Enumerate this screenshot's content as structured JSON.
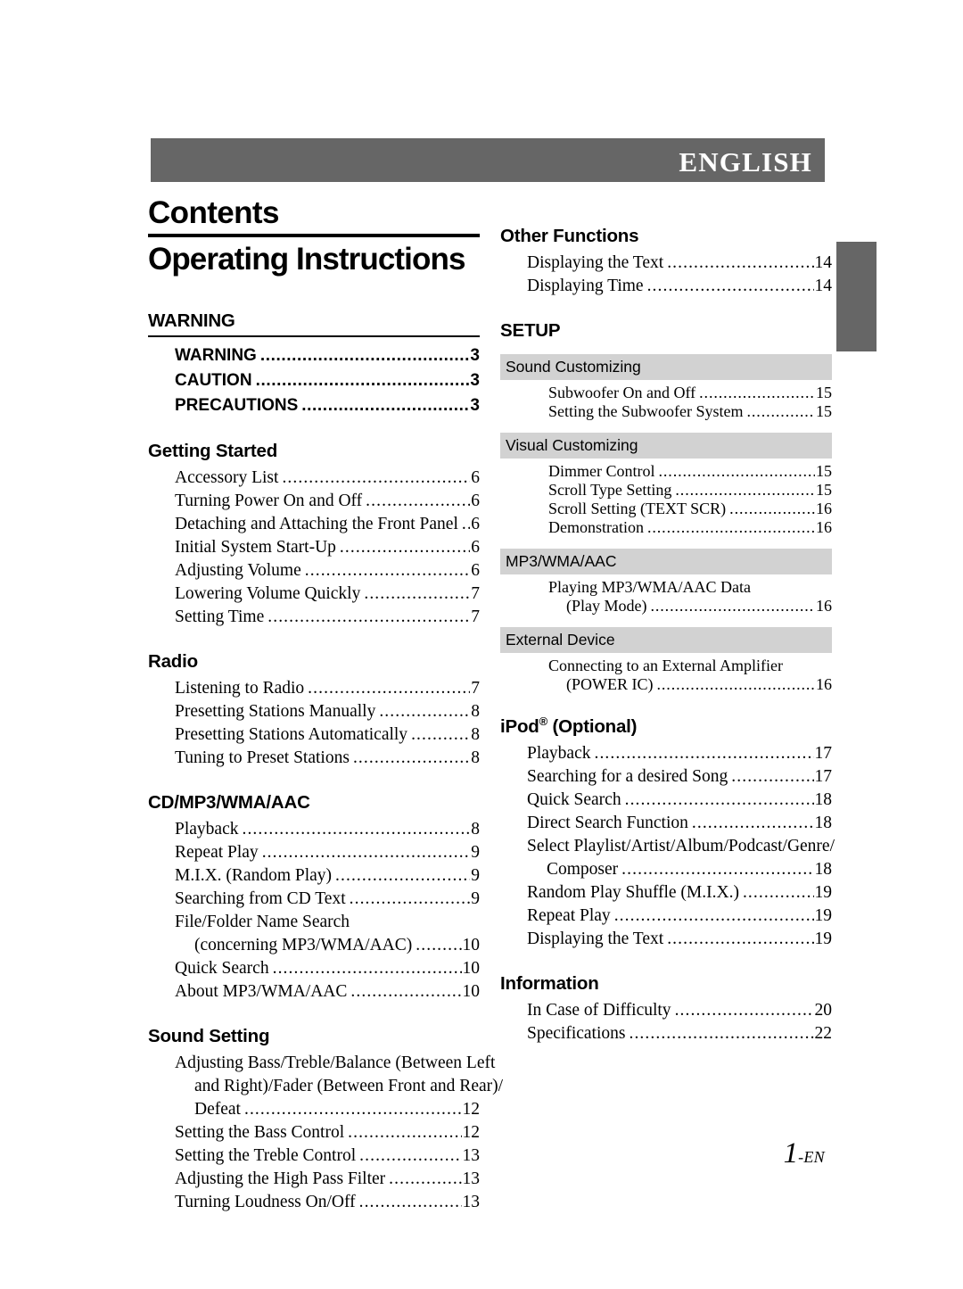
{
  "document": {
    "language_banner": "ENGLISH",
    "title": "Contents",
    "subtitle": "Operating Instructions",
    "folio_number": "1",
    "folio_suffix": "-EN"
  },
  "colors": {
    "banner_gray": "#666666",
    "subbar_gray": "#d2d2d2",
    "edge_tab_gray": "#666666"
  },
  "left_column": [
    {
      "heading": "WARNING",
      "rule": true,
      "style": "bold-sans",
      "entries": [
        {
          "label": "WARNING",
          "page": "3"
        },
        {
          "label": "CAUTION",
          "page": "3"
        },
        {
          "label": "PRECAUTIONS",
          "page": "3"
        }
      ]
    },
    {
      "heading": "Getting Started",
      "rule": false,
      "entries": [
        {
          "label": "Accessory List",
          "page": "6"
        },
        {
          "label": "Turning Power On and Off",
          "page": "6"
        },
        {
          "label": "Detaching and Attaching the Front Panel",
          "page": "6"
        },
        {
          "label": "Initial System Start-Up",
          "page": "6"
        },
        {
          "label": "Adjusting Volume",
          "page": "6"
        },
        {
          "label": "Lowering Volume Quickly",
          "page": "7"
        },
        {
          "label": "Setting Time",
          "page": "7"
        }
      ]
    },
    {
      "heading": "Radio",
      "rule": false,
      "entries": [
        {
          "label": "Listening to Radio",
          "page": "7"
        },
        {
          "label": "Presetting Stations Manually",
          "page": "8"
        },
        {
          "label": "Presetting Stations Automatically",
          "page": "8"
        },
        {
          "label": "Tuning to Preset Stations",
          "page": "8"
        }
      ]
    },
    {
      "heading": "CD/MP3/WMA/AAC",
      "rule": false,
      "entries": [
        {
          "label": "Playback",
          "page": "8"
        },
        {
          "label": "Repeat Play",
          "page": "9"
        },
        {
          "label": "M.I.X. (Random Play)",
          "page": "9"
        },
        {
          "label": "Searching from CD Text",
          "page": "9"
        },
        {
          "wrap": "File/Folder Name Search"
        },
        {
          "label": "(concerning MP3/WMA/AAC)",
          "page": "10",
          "cont": true
        },
        {
          "label": "Quick Search",
          "page": "10"
        },
        {
          "label": "About MP3/WMA/AAC",
          "page": "10"
        }
      ]
    },
    {
      "heading": "Sound Setting",
      "rule": false,
      "entries": [
        {
          "wrap": "Adjusting Bass/Treble/Balance (Between Left"
        },
        {
          "wrap": "and Right)/Fader (Between Front and Rear)/",
          "cont": true
        },
        {
          "label": "Defeat",
          "page": "12",
          "cont": true
        },
        {
          "label": "Setting the Bass Control",
          "page": "12"
        },
        {
          "label": "Setting the Treble Control",
          "page": "13"
        },
        {
          "label": "Adjusting the High Pass Filter",
          "page": "13"
        },
        {
          "label": "Turning Loudness On/Off",
          "page": "13"
        }
      ]
    }
  ],
  "right_column": [
    {
      "heading": "Other Functions",
      "rule": false,
      "entries": [
        {
          "label": "Displaying the Text",
          "page": "14"
        },
        {
          "label": "Displaying Time",
          "page": "14"
        }
      ]
    },
    {
      "heading": "SETUP",
      "rule": false,
      "entries": [],
      "subsections": [
        {
          "bar": "Sound Customizing",
          "entries": [
            {
              "label": "Subwoofer On and Off",
              "page": "15"
            },
            {
              "label": "Setting the Subwoofer System",
              "page": "15"
            }
          ]
        },
        {
          "bar": "Visual Customizing",
          "entries": [
            {
              "label": "Dimmer Control",
              "page": "15"
            },
            {
              "label": "Scroll Type Setting",
              "page": "15"
            },
            {
              "label": "Scroll Setting (TEXT SCR)",
              "page": "16"
            },
            {
              "label": "Demonstration",
              "page": "16"
            }
          ]
        },
        {
          "bar": "MP3/WMA/AAC",
          "entries": [
            {
              "wrap": "Playing MP3/WMA/AAC Data"
            },
            {
              "label": "(Play Mode)",
              "page": "16",
              "cont": true
            }
          ]
        },
        {
          "bar": "External Device",
          "entries": [
            {
              "wrap": "Connecting to an External Amplifier"
            },
            {
              "label": "(POWER IC)",
              "page": "16",
              "cont": true
            }
          ]
        }
      ]
    },
    {
      "heading": "iPod® (Optional)",
      "heading_main": "iPod",
      "heading_sup": "®",
      "heading_rest": " (Optional)",
      "rule": false,
      "entries": [
        {
          "label": "Playback",
          "page": "17"
        },
        {
          "label": "Searching for a desired Song",
          "page": "17"
        },
        {
          "label": "Quick Search",
          "page": "18"
        },
        {
          "label": "Direct Search Function",
          "page": "18"
        },
        {
          "wrap": "Select Playlist/Artist/Album/Podcast/Genre/"
        },
        {
          "label": "Composer",
          "page": "18",
          "cont": true
        },
        {
          "label": "Random Play Shuffle (M.I.X.)",
          "page": "19"
        },
        {
          "label": "Repeat Play",
          "page": "19"
        },
        {
          "label": "Displaying the Text",
          "page": "19"
        }
      ]
    },
    {
      "heading": "Information",
      "rule": false,
      "entries": [
        {
          "label": "In Case of Difficulty",
          "page": "20"
        },
        {
          "label": "Specifications",
          "page": "22"
        }
      ]
    }
  ]
}
